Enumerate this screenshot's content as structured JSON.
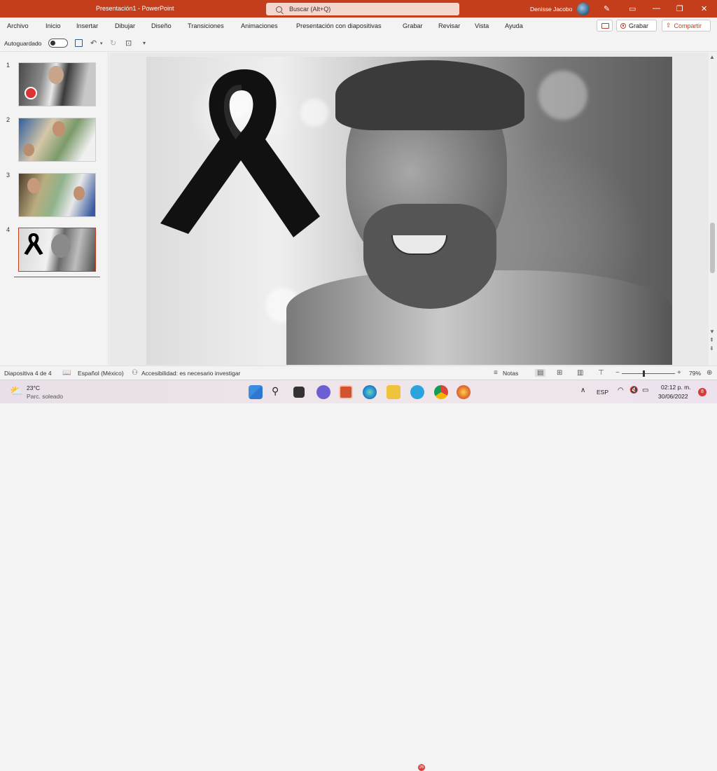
{
  "window": {
    "title": "Presentación1  -  PowerPoint",
    "search_placeholder": "Buscar (Alt+Q)",
    "user_name": "Denisse Jacobo"
  },
  "ribbon": {
    "tabs": [
      "Archivo",
      "Inicio",
      "Insertar",
      "Dibujar",
      "Diseño",
      "Transiciones",
      "Animaciones",
      "Presentación con diapositivas",
      "Grabar",
      "Revisar",
      "Vista",
      "Ayuda"
    ],
    "record_label": "Grabar",
    "share_label": "Compartir"
  },
  "qat": {
    "autosave_label": "Autoguardado"
  },
  "slides_panel": {
    "numbers": [
      "1",
      "2",
      "3",
      "4"
    ],
    "selected": 4
  },
  "status": {
    "slide_info": "Diapositiva 4 de 4",
    "language": "Español (México)",
    "accessibility": "Accesibilidad: es necesario investigar",
    "notes_label": "Notas",
    "zoom": "79%"
  },
  "taskbar": {
    "temperature": "23°C",
    "weather": "Parc. soleado",
    "input_lang": "ESP",
    "time": "02:12 p. m.",
    "date": "30/06/2022",
    "notification_count": "8",
    "telegram_badge": "26"
  },
  "colors": {
    "accent": "#c43e1c",
    "titlebar": "#c43e1c"
  }
}
